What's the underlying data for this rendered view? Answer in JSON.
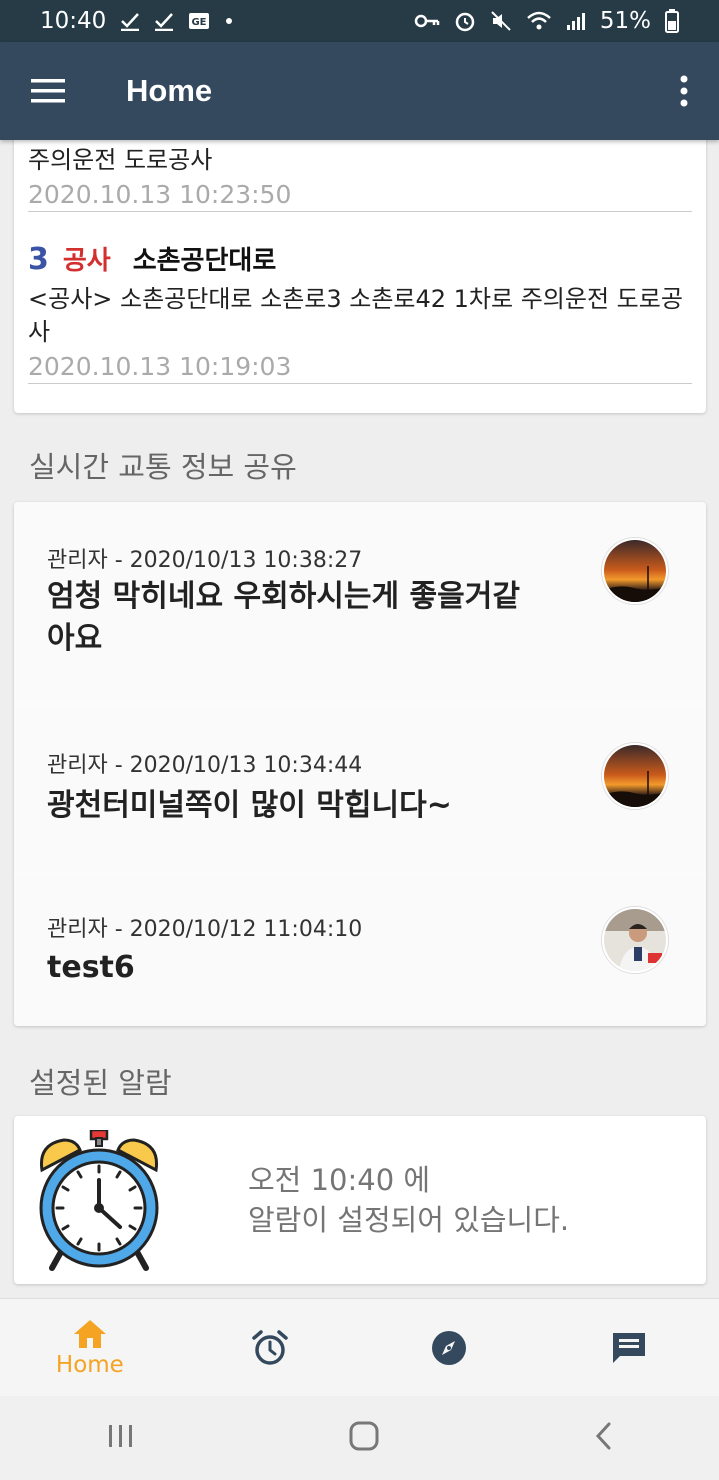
{
  "status_bar": {
    "time": "10:40",
    "battery": "51%"
  },
  "app_bar": {
    "title": "Home"
  },
  "notices": [
    {
      "desc": "주의운전 도로공사",
      "time": "2020.10.13 10:23:50"
    },
    {
      "number": "3",
      "category": "공사",
      "road": "소촌공단대로",
      "desc": "<공사> 소촌공단대로 소촌로3 소촌로42 1차로 주의운전 도로공사",
      "time": "2020.10.13 10:19:03"
    }
  ],
  "share_section": {
    "title": "실시간 교통 정보 공유",
    "posts": [
      {
        "meta": "관리자 - 2020/10/13 10:38:27",
        "text": "엄청 막히네요 우회하시는게 좋을거같아요"
      },
      {
        "meta": "관리자 - 2020/10/13 10:34:44",
        "text": "광천터미널쪽이 많이 막힙니다~"
      },
      {
        "meta": "관리자 - 2020/10/12 11:04:10",
        "text": "test6"
      }
    ]
  },
  "alarm_section": {
    "title": "설정된 알람",
    "line1": "오전 10:40 에",
    "line2": "알람이 설정되어 있습니다."
  },
  "bottom_nav": {
    "home_label": "Home"
  },
  "colors": {
    "app_bar": "#34495e",
    "status_bar": "#263b45",
    "accent": "#f4a422",
    "notice_number": "#3b53a5",
    "notice_category": "#d32f2f"
  }
}
